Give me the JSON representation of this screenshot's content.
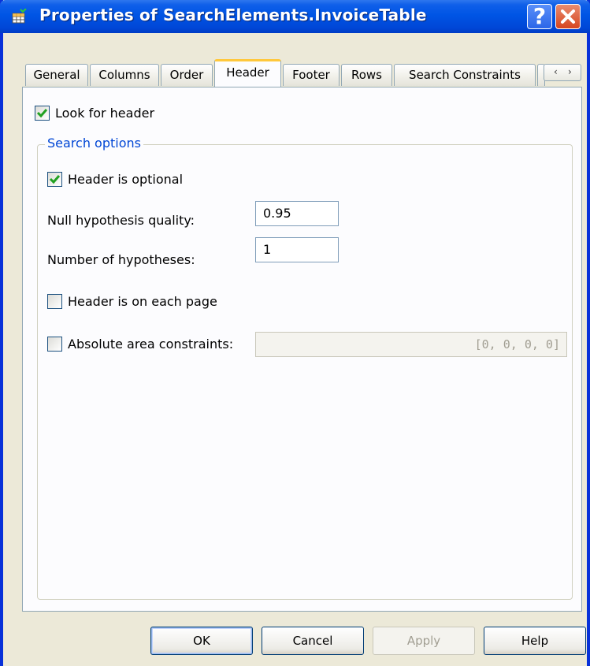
{
  "window": {
    "title": "Properties of SearchElements.InvoiceTable",
    "help_glyph": "?",
    "accent_color": "#0055e5"
  },
  "tabs": [
    {
      "label": "General",
      "active": false
    },
    {
      "label": "Columns",
      "active": false
    },
    {
      "label": "Order",
      "active": false
    },
    {
      "label": "Header",
      "active": true
    },
    {
      "label": "Footer",
      "active": false
    },
    {
      "label": "Rows",
      "active": false
    },
    {
      "label": "Search Constraints",
      "active": false
    }
  ],
  "tab_scroll": {
    "left": "‹",
    "right": "›"
  },
  "header_page": {
    "look_for_header": {
      "label": "Look for header",
      "checked": true
    },
    "search_options": {
      "legend": "Search options",
      "header_optional": {
        "label": "Header is optional",
        "checked": true
      },
      "null_hypothesis": {
        "label": "Null hypothesis quality:",
        "value": "0.95"
      },
      "num_hypotheses": {
        "label": "Number of hypotheses:",
        "value": "1"
      },
      "each_page": {
        "label": "Header is on each page",
        "checked": false
      },
      "absolute_area": {
        "label": "Absolute area constraints:",
        "checked": false,
        "value": "[0, 0, 0, 0]"
      }
    }
  },
  "buttons": {
    "ok": "OK",
    "cancel": "Cancel",
    "apply": "Apply",
    "help": "Help"
  }
}
